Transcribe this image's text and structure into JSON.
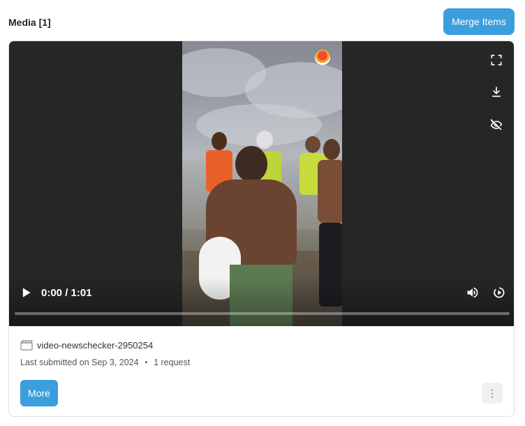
{
  "header": {
    "title": "Media [1]",
    "merge_label": "Merge Items"
  },
  "player": {
    "current_time": "0:00",
    "duration": "1:01",
    "time_display": "0:00 / 1:01",
    "progress": 0,
    "icons": [
      "fullscreen-icon",
      "download-icon",
      "hide-icon",
      "play-icon",
      "volume-icon",
      "playback-speed-icon"
    ],
    "watermark": "UNITE TV"
  },
  "item": {
    "name": "video-newschecker-2950254",
    "submitted": "Last submitted on Sep 3, 2024",
    "separator": "•",
    "requests": "1 request",
    "more_label": "More",
    "menu_glyph": "⋮"
  },
  "colors": {
    "accent": "#3a9fdc",
    "player_bg": "#262626"
  }
}
